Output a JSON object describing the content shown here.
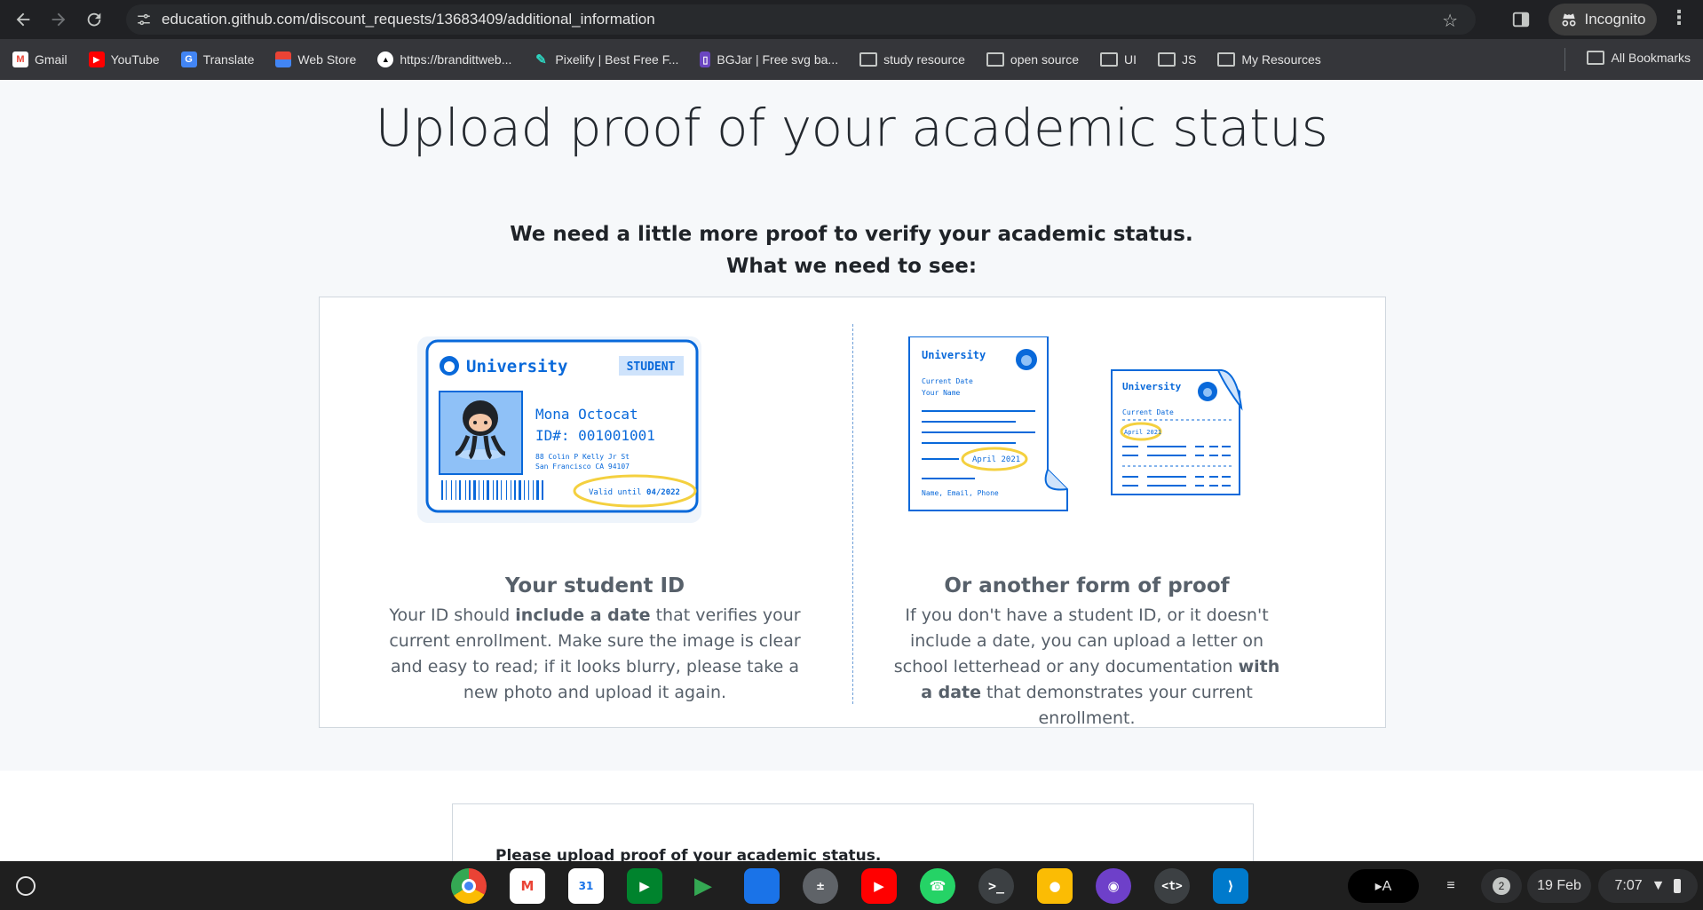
{
  "browser": {
    "url": "education.github.com/discount_requests/13683409/additional_information",
    "profile_label": "Incognito"
  },
  "bookmarks": [
    {
      "label": "Gmail",
      "icon": "gmail-icon"
    },
    {
      "label": "YouTube",
      "icon": "youtube-icon"
    },
    {
      "label": "Translate",
      "icon": "translate-icon"
    },
    {
      "label": "Web Store",
      "icon": "webstore-icon"
    },
    {
      "label": "https://brandittweb...",
      "icon": "triangle-icon"
    },
    {
      "label": "Pixelify | Best Free F...",
      "icon": "feather-icon"
    },
    {
      "label": "BGJar | Free svg ba...",
      "icon": "bgjar-icon"
    },
    {
      "label": "study resource",
      "icon": "folder-icon"
    },
    {
      "label": "open source",
      "icon": "folder-icon"
    },
    {
      "label": "UI",
      "icon": "folder-icon"
    },
    {
      "label": "JS",
      "icon": "folder-icon"
    },
    {
      "label": "My Resources",
      "icon": "folder-icon"
    }
  ],
  "all_bookmarks_label": "All Bookmarks",
  "page": {
    "title": "Upload proof of your academic status",
    "subtitle_1": "We need a little more proof to verify your academic status.",
    "subtitle_2": "What we need to see:",
    "student_id": {
      "heading": "Your student ID",
      "text_1": "Your ID should ",
      "text_bold": "include a date",
      "text_2": " that verifies your current enrollment. Make sure the image is clear and easy to read; if it looks blurry, please take a new photo and upload it again."
    },
    "other_proof": {
      "heading": "Or another form of proof",
      "text_1": "If you don't have a student ID, or it doesn't include a date, you can upload a letter on school letterhead or any documentation ",
      "text_bold": "with a date",
      "text_2": " that demonstrates your current enrollment."
    },
    "id_card": {
      "university": "University",
      "badge": "STUDENT",
      "name": "Mona Octocat",
      "id_number": "ID#: 001001001",
      "address_1": "88 Colin P Kelly Jr St",
      "address_2": "San Francisco CA 94107",
      "valid_label": "Valid until ",
      "valid_date": "04/2022"
    },
    "letter_1": {
      "university": "University",
      "line_1": "Current Date",
      "line_2": "Your Name",
      "date": "April 2021",
      "footer": "Name, Email, Phone"
    },
    "letter_2": {
      "university": "University",
      "line_1": "Current Date",
      "date": "April 2021"
    },
    "lower_prompt": "Please upload proof of your academic status."
  },
  "shelf": {
    "date": "19 Feb",
    "time": "7:07",
    "notification_count": "2"
  },
  "colors": {
    "accent_blue": "#0969da",
    "highlight_yellow": "#f4d03f",
    "chrome_dark": "#202124"
  }
}
